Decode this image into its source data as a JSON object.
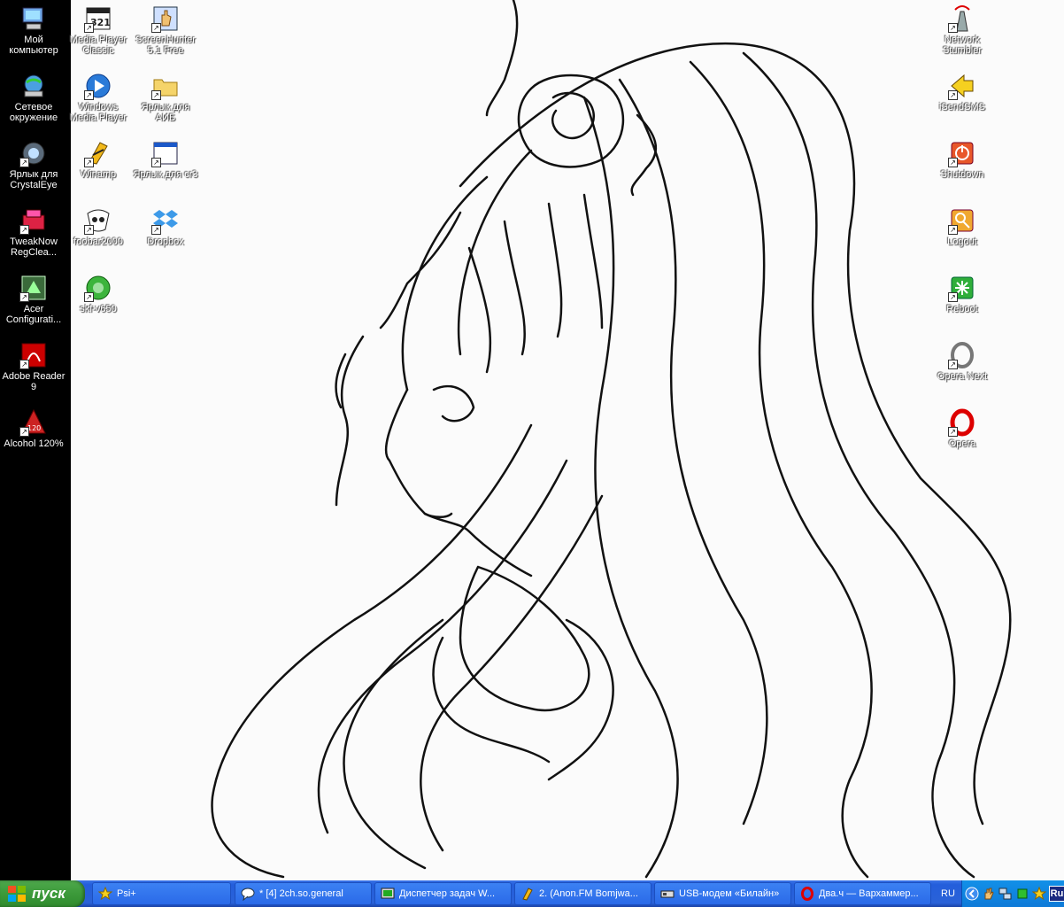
{
  "desktop": {
    "left_icons": [
      {
        "label": "Мой компьютер",
        "icon": "my-computer-icon"
      },
      {
        "label": "Сетевое окружение",
        "icon": "network-places-icon"
      },
      {
        "label": "Ярлык для CrystalEye",
        "icon": "crystaleye-icon"
      },
      {
        "label": "TweakNow RegClea...",
        "icon": "tweaknow-icon"
      },
      {
        "label": "Acer Configurati...",
        "icon": "acer-config-icon"
      },
      {
        "label": "Adobe Reader 9",
        "icon": "adobe-reader-icon"
      },
      {
        "label": "Alcohol 120%",
        "icon": "alcohol-icon"
      }
    ],
    "col2_icons": [
      {
        "label": "Media Player Classic",
        "icon": "media-player-classic-icon"
      },
      {
        "label": "Windows Media Player",
        "icon": "windows-media-player-icon"
      },
      {
        "label": "Winamp",
        "icon": "winamp-icon"
      },
      {
        "label": "foobar2000",
        "icon": "foobar-icon"
      },
      {
        "label": "skf-v650",
        "icon": "skf-icon"
      }
    ],
    "col3_icons": [
      {
        "label": "ScreenHunter 5.1 Free",
        "icon": "screenhunter-icon"
      },
      {
        "label": "Ярлык для АИБ",
        "icon": "folder-icon"
      },
      {
        "label": "Ярлык для cr3",
        "icon": "window-icon"
      },
      {
        "label": "Dropbox",
        "icon": "dropbox-icon"
      }
    ],
    "right_icons": [
      {
        "label": "Network Stumbler",
        "icon": "network-stumbler-icon"
      },
      {
        "label": "iSendSMS",
        "icon": "isendsms-icon"
      },
      {
        "label": "Shutdown",
        "icon": "shutdown-icon"
      },
      {
        "label": "Logout",
        "icon": "logout-icon"
      },
      {
        "label": "Reboot",
        "icon": "reboot-icon"
      },
      {
        "label": "Opera Next",
        "icon": "opera-next-icon"
      },
      {
        "label": "Opera",
        "icon": "opera-icon"
      }
    ]
  },
  "taskbar": {
    "start_label": "пуск",
    "tasks": [
      {
        "label": "Psi+",
        "icon": "star-icon"
      },
      {
        "label": "* [4] 2ch.so.general",
        "icon": "chat-bubble-icon"
      },
      {
        "label": "Диспетчер задач W...",
        "icon": "task-manager-icon"
      },
      {
        "label": "2. (Anon.FM Bomjwa...",
        "icon": "winamp-icon"
      },
      {
        "label": "USB-модем «Билайн»",
        "icon": "modem-icon"
      },
      {
        "label": "Два.ч — Вархаммер...",
        "icon": "opera-icon"
      }
    ],
    "language": "RU",
    "tray_language": "Ru",
    "tray_icons": [
      "chevron-left-icon",
      "hand-icon",
      "network-icon",
      "green-status-icon",
      "star-icon"
    ]
  },
  "colors": {
    "taskbar": "#245edb",
    "start": "#3c9a3a",
    "tray": "#0e7ad8",
    "left_strip": "#000000"
  }
}
